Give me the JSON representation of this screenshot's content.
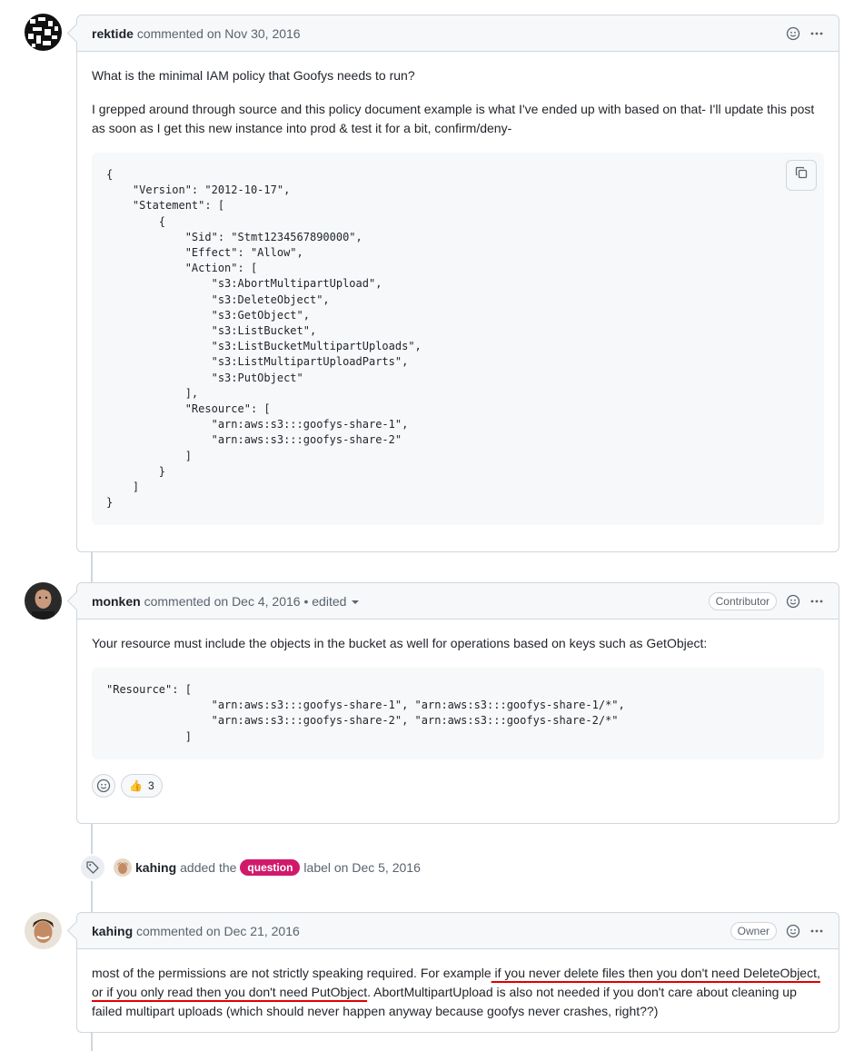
{
  "comments": [
    {
      "author": "rektide",
      "meta": "commented on Nov 30, 2016",
      "paragraphs": [
        "What is the minimal IAM policy that Goofys needs to run?",
        "I grepped around through source and this policy document example is what I've ended up with based on that- I'll update this post as soon as I get this new instance into prod & test it for a bit, confirm/deny-"
      ],
      "code": "{\n    \"Version\": \"2012-10-17\",\n    \"Statement\": [\n        {\n            \"Sid\": \"Stmt1234567890000\",\n            \"Effect\": \"Allow\",\n            \"Action\": [\n                \"s3:AbortMultipartUpload\",\n                \"s3:DeleteObject\",\n                \"s3:GetObject\",\n                \"s3:ListBucket\",\n                \"s3:ListBucketMultipartUploads\",\n                \"s3:ListMultipartUploadParts\",\n                \"s3:PutObject\"\n            ],\n            \"Resource\": [\n                \"arn:aws:s3:::goofys-share-1\",\n                \"arn:aws:s3:::goofys-share-2\"\n            ]\n        }\n    ]\n}"
    },
    {
      "author": "monken",
      "meta": "commented on Dec 4, 2016",
      "edited": "• edited",
      "badge": "Contributor",
      "paragraphs": [
        "Your resource must include the objects in the bucket as well for operations based on keys such as GetObject:"
      ],
      "code": "\"Resource\": [\n                \"arn:aws:s3:::goofys-share-1\", \"arn:aws:s3:::goofys-share-1/*\",\n                \"arn:aws:s3:::goofys-share-2\", \"arn:aws:s3:::goofys-share-2/*\"\n            ]",
      "reaction_emoji": "👍",
      "reaction_count": "3"
    },
    {
      "author": "kahing",
      "meta": "commented on Dec 21, 2016",
      "badge": "Owner",
      "text_before": "most of the permissions are not strictly speaking required. For example",
      "text_underlined": " if you never delete files then you don't need DeleteObject, or if you only read then you don't need PutObject",
      "text_after": ". AbortMultipartUpload is also not needed if you don't care about cleaning up failed multipart uploads (which should never happen anyway because goofys never crashes, right??)"
    }
  ],
  "label_event": {
    "actor": "kahing",
    "before": "added the",
    "label": "question",
    "after": "label on Dec 5, 2016"
  },
  "icons": {
    "emoji": "smiley-icon",
    "more": "kebab-horizontal-icon",
    "copy": "copy-icon",
    "tag": "tag-icon"
  },
  "colors": {
    "label_question": "#d1196b",
    "annotation_underline": "#e00000"
  }
}
